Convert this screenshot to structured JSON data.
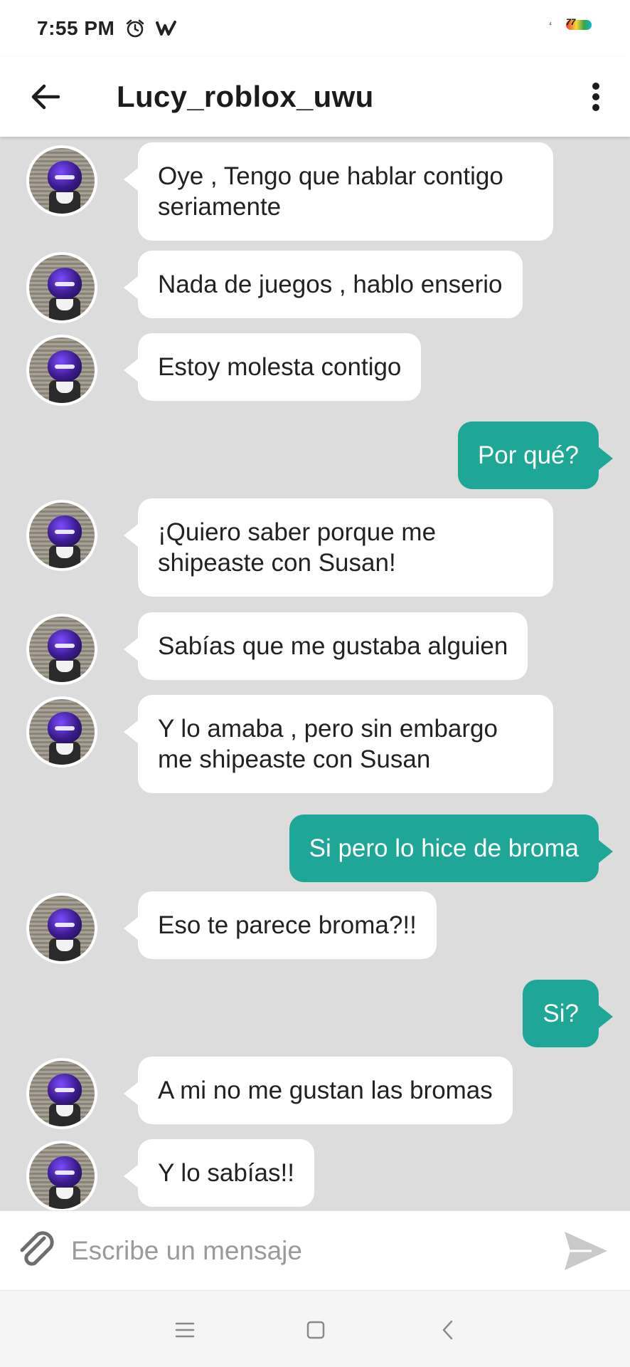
{
  "status_bar": {
    "time": "7:55 PM",
    "icons": [
      "alarm-icon",
      "wattpad-icon"
    ],
    "battery_text": "77"
  },
  "header": {
    "title": "Lucy_roblox_uwu",
    "back_icon": "arrow-left-icon",
    "menu_icon": "more-vertical-icon"
  },
  "messages": [
    {
      "side": "in",
      "text": "Oye , Tengo que hablar contigo seriamente"
    },
    {
      "side": "in",
      "text": "Nada de juegos , hablo enserio"
    },
    {
      "side": "in",
      "text": "Estoy molesta contigo"
    },
    {
      "side": "out",
      "text": "Por qué?"
    },
    {
      "side": "in",
      "text": "¡Quiero saber porque me shipeaste con Susan!"
    },
    {
      "side": "in",
      "text": "Sabías que me gustaba alguien"
    },
    {
      "side": "in",
      "text": "Y lo amaba , pero sin embargo me shipeaste con Susan"
    },
    {
      "side": "out",
      "text": "Si pero lo hice de broma"
    },
    {
      "side": "in",
      "text": "Eso te parece broma?!!"
    },
    {
      "side": "out",
      "text": "Si?"
    },
    {
      "side": "in",
      "text": "A mi no me gustan las bromas"
    },
    {
      "side": "in",
      "text": "Y lo sabías!!"
    }
  ],
  "composer": {
    "placeholder": "Escribe un mensaje",
    "attach_icon": "paperclip-icon",
    "send_icon": "send-icon"
  },
  "nav_bar": {
    "icons": [
      "menu-icon",
      "home-square-icon",
      "back-chevron-icon"
    ]
  },
  "colors": {
    "background": "#dcdcdc",
    "incoming_bubble": "#ffffff",
    "outgoing_bubble": "#1ea697"
  }
}
